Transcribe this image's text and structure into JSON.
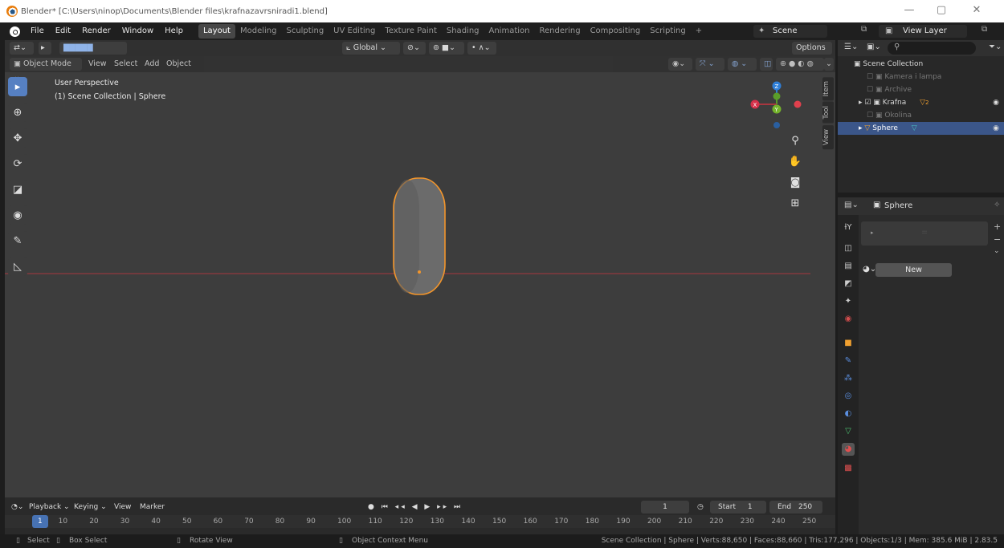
{
  "window": {
    "title": "Blender* [C:\\Users\\ninop\\Documents\\Blender files\\krafnazavrsniradi1.blend]",
    "minimize": "—",
    "maximize": "▢",
    "close": "✕"
  },
  "menu": {
    "items": [
      "File",
      "Edit",
      "Render",
      "Window",
      "Help"
    ],
    "workspaces": [
      "Layout",
      "Modeling",
      "Sculpting",
      "UV Editing",
      "Texture Paint",
      "Shading",
      "Animation",
      "Rendering",
      "Compositing",
      "Scripting"
    ],
    "active_workspace": "Layout",
    "add_tab": "+",
    "scene": "Scene",
    "view_layer": "View Layer"
  },
  "viewport": {
    "transform_orientation": "Global",
    "options_label": "Options",
    "mode": "Object Mode",
    "header_menus": [
      "View",
      "Select",
      "Add",
      "Object"
    ],
    "perspective": "User Perspective",
    "collection_info": "(1) Scene Collection | Sphere",
    "side_tabs": [
      "Item",
      "Tool",
      "View"
    ],
    "gizmo": {
      "x": "X",
      "y": "Y",
      "z": "Z"
    },
    "colors": {
      "bg": "#3d3d3d",
      "x_axis": "#d6314a",
      "y_axis": "#75b32c",
      "z_axis": "#2f7fd8",
      "selection": "#f2952b"
    }
  },
  "timeline": {
    "menus": [
      "Playback",
      "Keying",
      "View",
      "Marker"
    ],
    "current_frame": "1",
    "start_label": "Start",
    "start": "1",
    "end_label": "End",
    "end": "250",
    "ticks": [
      "1",
      "10",
      "20",
      "30",
      "40",
      "50",
      "60",
      "70",
      "80",
      "90",
      "100",
      "110",
      "120",
      "130",
      "140",
      "150",
      "160",
      "170",
      "180",
      "190",
      "200",
      "210",
      "220",
      "230",
      "240",
      "250"
    ]
  },
  "statusbar": {
    "select": "Select",
    "box_select": "Box Select",
    "rotate_view": "Rotate View",
    "context_menu": "Object Context Menu",
    "stats": "Scene Collection | Sphere | Verts:88,650 | Faces:88,660 | Tris:177,296 | Objects:1/3 | Mem: 385.6 MiB | 2.83.5"
  },
  "outliner": {
    "root": "Scene Collection",
    "items": [
      {
        "label": "Kamera i lampa",
        "checked": false,
        "state": "dim"
      },
      {
        "label": "Archive",
        "checked": false,
        "state": "dim"
      },
      {
        "label": "Krafna",
        "checked": true,
        "state": "normal",
        "badge": "2"
      },
      {
        "label": "Okolina",
        "checked": false,
        "state": "dim"
      },
      {
        "label": "Sphere",
        "checked": true,
        "state": "selected"
      }
    ]
  },
  "properties": {
    "object_name": "Sphere",
    "new_button": "New",
    "add": "+",
    "tabs": [
      "tool",
      "render",
      "output",
      "view-layer",
      "scene",
      "world",
      "object",
      "modifier",
      "particles",
      "physics",
      "constraints",
      "data",
      "material",
      "texture"
    ]
  }
}
